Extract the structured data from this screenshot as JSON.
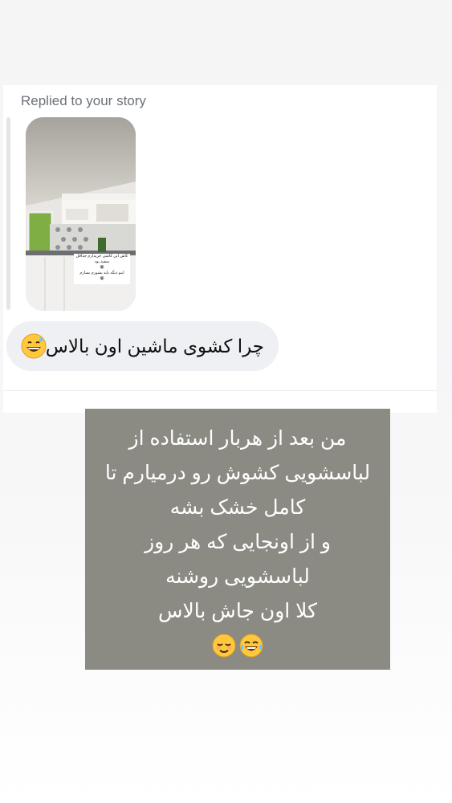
{
  "reply_label": "Replied to your story",
  "story_thumbnail": {
    "caption_lines": [
      "کاش این کاشی خریدارم جداقل",
      "سفید بود",
      "😭",
      "اینو دیگه باید بشورم بسازم",
      "😭"
    ]
  },
  "message": {
    "text": "چرا کشوی ماشین اون بالاس",
    "emoji": "grinning-sweat-emoji"
  },
  "story_reply": {
    "lines": [
      "من بعد از هربار استفاده از",
      "لباسشویی کشوش رو درمیارم تا",
      "کامل خشک بشه",
      "و از اونجایی که هر روز",
      "لباسشویی روشنه",
      "کلا اون جاش بالاس"
    ],
    "emojis": [
      "relieved-face-emoji",
      "tears-of-joy-emoji"
    ],
    "background": "#8b8b84"
  }
}
